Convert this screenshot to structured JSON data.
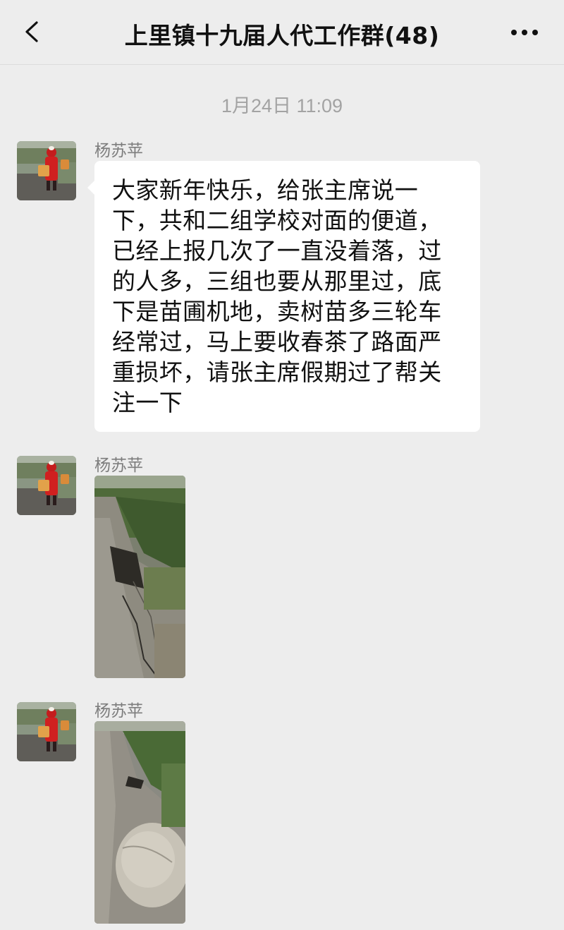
{
  "header": {
    "title": "上里镇十九届人代工作群(48)",
    "back_icon": "chevron-left-icon",
    "more_icon": "more-dots-icon"
  },
  "timestamp": "1月24日 11:09",
  "messages": [
    {
      "sender": "杨苏苹",
      "type": "text",
      "text": "大家新年快乐，给张主席说一下，共和二组学校对面的便道，已经上报几次了一直没着落，过的人多，三组也要从那里过，底下是苗圃机地，卖树苗多三轮车经常过，马上要收春茶了路面严重损坏，请张主席假期过了帮关注一下"
    },
    {
      "sender": "杨苏苹",
      "type": "image"
    },
    {
      "sender": "杨苏苹",
      "type": "image"
    }
  ],
  "colors": {
    "background": "#ededed",
    "bubble": "#ffffff",
    "text": "#111111",
    "sender": "#7d7d7d",
    "timestamp": "#a3a3a3"
  }
}
